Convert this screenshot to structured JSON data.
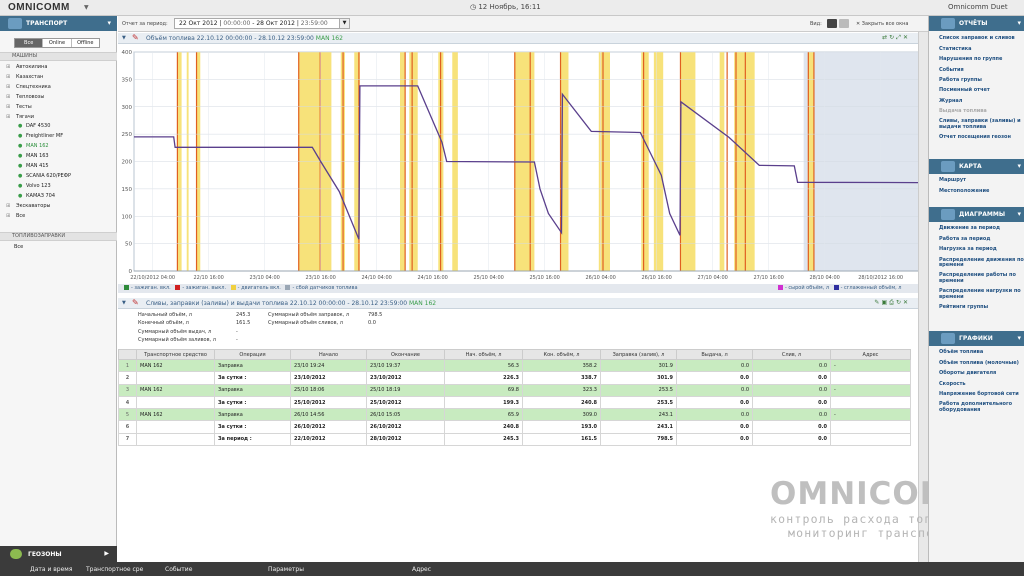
{
  "app": {
    "logo": "OMNICOMM",
    "clock": "12 Ноябрь, 16:11",
    "user": "Omnicomm Duet"
  },
  "left": {
    "header": "ТРАНСПОРТ",
    "filter_tabs": [
      "Все",
      "Online",
      "Offline"
    ],
    "sec_vehicles": "МАШИНЫ",
    "tree": [
      {
        "label": "Автокилина",
        "level": 1
      },
      {
        "label": "Казахстан",
        "level": 1
      },
      {
        "label": "Спецтехника",
        "level": 1
      },
      {
        "label": "Тепловозы",
        "level": 1
      },
      {
        "label": "Тесты",
        "level": 1
      },
      {
        "label": "Тягачи",
        "level": 1
      },
      {
        "label": "DAF 4530",
        "level": 2
      },
      {
        "label": "Freightliner MF",
        "level": 2
      },
      {
        "label": "MAN 162",
        "level": 2,
        "selected": true
      },
      {
        "label": "MAN 163",
        "level": 2
      },
      {
        "label": "MAN 415",
        "level": 2
      },
      {
        "label": "SCANIA 620/РЕФР",
        "level": 2
      },
      {
        "label": "Volvo 123",
        "level": 2
      },
      {
        "label": "КАМАЗ 704",
        "level": 2
      },
      {
        "label": "Экскаваторы",
        "level": 1
      },
      {
        "label": "Все",
        "level": 1
      }
    ],
    "sec_stations": "ТОПЛИВОЗАПРАВКИ",
    "stations_all": "Все",
    "geozones": "ГЕОЗОНЫ"
  },
  "filter": {
    "period_label": "Отчет за период:",
    "date_from": "22 Окт 2012",
    "time_from": "00:00:00",
    "date_to": "28 Окт 2012",
    "time_to": "23:59:00",
    "view_label": "Вид:",
    "hide_all": "Закрыть все окна"
  },
  "chart_panel": {
    "title": "Объём топлива 22.10.12 00:00:00 - 28.10.12 23:59:00",
    "vehicle": "MAN 162"
  },
  "chart_data": {
    "type": "line",
    "ylim": [
      0,
      400
    ],
    "yticks": [
      "0",
      "50",
      "100",
      "150",
      "200",
      "250",
      "300",
      "350",
      "400"
    ],
    "xticks": [
      "22/10/2012 04:00",
      "22/10 16:00",
      "23/10 04:00",
      "23/10 16:00",
      "24/10 04:00",
      "24/10 16:00",
      "25/10 04:00",
      "25/10 16:00",
      "26/10 04:00",
      "26/10 16:00",
      "27/10 04:00",
      "27/10 16:00",
      "28/10 04:00",
      "28/10/2012 16:00"
    ],
    "x_hours": [
      4,
      16,
      28,
      40,
      52,
      64,
      76,
      88,
      100,
      112,
      124,
      136,
      148,
      160
    ],
    "x_range_hours": [
      0,
      168
    ],
    "series_color": "#5a3f8c",
    "series": [
      {
        "t": 0,
        "v": 245
      },
      {
        "t": 8.5,
        "v": 245
      },
      {
        "t": 8.8,
        "v": 226
      },
      {
        "t": 38.2,
        "v": 226
      },
      {
        "t": 40,
        "v": 200
      },
      {
        "t": 44,
        "v": 145
      },
      {
        "t": 48.2,
        "v": 58
      },
      {
        "t": 48.4,
        "v": 338
      },
      {
        "t": 60.8,
        "v": 338
      },
      {
        "t": 66,
        "v": 235
      },
      {
        "t": 67,
        "v": 200
      },
      {
        "t": 85.8,
        "v": 199
      },
      {
        "t": 87,
        "v": 150
      },
      {
        "t": 88.8,
        "v": 105
      },
      {
        "t": 91.6,
        "v": 70
      },
      {
        "t": 91.8,
        "v": 323
      },
      {
        "t": 98,
        "v": 255
      },
      {
        "t": 108.5,
        "v": 253
      },
      {
        "t": 113,
        "v": 175
      },
      {
        "t": 114.8,
        "v": 105
      },
      {
        "t": 117,
        "v": 65
      },
      {
        "t": 117.2,
        "v": 309
      },
      {
        "t": 127.5,
        "v": 244
      },
      {
        "t": 134,
        "v": 193
      },
      {
        "t": 141.5,
        "v": 192
      },
      {
        "t": 142.2,
        "v": 162
      },
      {
        "t": 168,
        "v": 161.5
      }
    ],
    "ignition_color": "#f7e27a",
    "ignition": [
      [
        9.3,
        10.2
      ],
      [
        11.3,
        11.7
      ],
      [
        13.4,
        14.2
      ],
      [
        35.2,
        42.3
      ],
      [
        44.3,
        45.2
      ],
      [
        47.2,
        48.4
      ],
      [
        57,
        58.1
      ],
      [
        59,
        60.8
      ],
      [
        65.2,
        66.3
      ],
      [
        68.2,
        69.4
      ],
      [
        81.5,
        85.8
      ],
      [
        91.4,
        93.1
      ],
      [
        99.6,
        102
      ],
      [
        108.7,
        110.3
      ],
      [
        111.4,
        113.4
      ],
      [
        117,
        120.3
      ],
      [
        125.5,
        126.5
      ],
      [
        128.6,
        133
      ],
      [
        144.4,
        145.8
      ]
    ],
    "drain_color": "#e06020",
    "drains": [
      9.3,
      13.4,
      35.3,
      39.9,
      44.8,
      48.2,
      58.1,
      59.6,
      65.7,
      81.6,
      84.9,
      91.4,
      100.5,
      109.2,
      117.1,
      127.1,
      129,
      131,
      144.5,
      145.7
    ],
    "no_data": [
      [
        143.5,
        168
      ]
    ],
    "no_data_color": "#dfe5ee"
  },
  "legend": {
    "left": [
      "- зажиган. вкл.",
      "- зажиган. выкл.",
      "- двигатель вкл.",
      "- сбой датчиков топлива"
    ],
    "right": [
      "- сырой объём, л",
      "- сглаженный объём, л"
    ],
    "colors": {
      "ign_on": "#2e8b3a",
      "ign_off": "#d02020",
      "engine": "#f0d040",
      "fail": "#9aa7b5",
      "raw": "#d030d0",
      "smooth": "#3030a0"
    }
  },
  "table_panel": {
    "title": "Сливы, заправки (заливы) и выдачи топлива 22.10.12 00:00:00 - 28.10.12 23:59:00",
    "vehicle": "MAN 162"
  },
  "summary": {
    "start_label": "Начальный объём, л",
    "start_val": "245.3",
    "end_label": "Конечный объём, л",
    "end_val": "161.5",
    "issued_label": "Суммарный объём выдач, л",
    "issued_val": "-",
    "intake_label": "Суммарный объём заливов, л",
    "intake_val": "-",
    "refuel_label": "Суммарный объём заправок, л",
    "refuel_val": "798.5",
    "drain_label": "Суммарный объём сливов, л",
    "drain_val": "0.0"
  },
  "table": {
    "columns": [
      "Транспортное средство",
      "Операция",
      "Начало",
      "Окончание",
      "Нач. объём, л",
      "Кон. объём, л",
      "Заправка (залив), л",
      "Выдача, л",
      "Слив, л",
      "Адрес"
    ],
    "rows": [
      {
        "n": "1",
        "type": "g",
        "cells": [
          "MAN 162",
          "Заправка",
          "23/10 19:24",
          "23/10 19:37",
          "56.3",
          "358.2",
          "301.9",
          "0.0",
          "0.0",
          "-"
        ]
      },
      {
        "n": "2",
        "type": "b",
        "cells": [
          "",
          "За сутки :",
          "23/10/2012",
          "23/10/2012",
          "226.3",
          "338.7",
          "301.9",
          "0.0",
          "0.0",
          ""
        ]
      },
      {
        "n": "3",
        "type": "g",
        "cells": [
          "MAN 162",
          "Заправка",
          "25/10 18:06",
          "25/10 18:19",
          "69.8",
          "323.3",
          "253.5",
          "0.0",
          "0.0",
          "-"
        ]
      },
      {
        "n": "4",
        "type": "b",
        "cells": [
          "",
          "За сутки :",
          "25/10/2012",
          "25/10/2012",
          "199.3",
          "240.8",
          "253.5",
          "0.0",
          "0.0",
          ""
        ]
      },
      {
        "n": "5",
        "type": "g",
        "cells": [
          "MAN 162",
          "Заправка",
          "26/10 14:56",
          "26/10 15:05",
          "65.9",
          "309.0",
          "243.1",
          "0.0",
          "0.0",
          "-"
        ]
      },
      {
        "n": "6",
        "type": "b",
        "cells": [
          "",
          "За сутки :",
          "26/10/2012",
          "26/10/2012",
          "240.8",
          "193.0",
          "243.1",
          "0.0",
          "0.0",
          ""
        ]
      },
      {
        "n": "7",
        "type": "b",
        "cells": [
          "",
          "За период :",
          "22/10/2012",
          "28/10/2012",
          "245.3",
          "161.5",
          "798.5",
          "0.0",
          "0.0",
          ""
        ]
      }
    ]
  },
  "right": {
    "reports_header": "ОТЧЁТЫ",
    "reports": [
      "Список заправок и сливов",
      "Статистика",
      "Нарушения по группе",
      "События",
      "Работа группы",
      "Посменный отчет",
      "Журнал",
      "Выдача топлива",
      "Сливы, заправки (заливы) и выдачи топлива",
      "Отчет посещения геозон"
    ],
    "map_header": "КАРТА",
    "map": [
      "Маршрут",
      "Местоположение"
    ],
    "diagrams_header": "ДИАГРАММЫ",
    "diagrams": [
      "Движение за период",
      "Работа за период",
      "Нагрузка за период",
      "Распределение движения по времени",
      "Распределение работы по времени",
      "Распределение нагрузки по времени",
      "Рейтинги группы"
    ],
    "graphs_header": "ГРАФИКИ",
    "graphs": [
      "Объём топлива",
      "Объём топлива (молочные)",
      "Обороты двигателя",
      "Скорость",
      "Напряжение бортовой сети",
      "Работа дополнительного оборудования"
    ]
  },
  "watermark": {
    "logo": "OMNICOMM",
    "line1": "контроль расхода топлива",
    "line2": "мониторинг транспорта"
  },
  "events": {
    "cols": [
      "Дата и время",
      "Транспортное сре",
      "Событие",
      "Параметры",
      "Адрес"
    ]
  }
}
